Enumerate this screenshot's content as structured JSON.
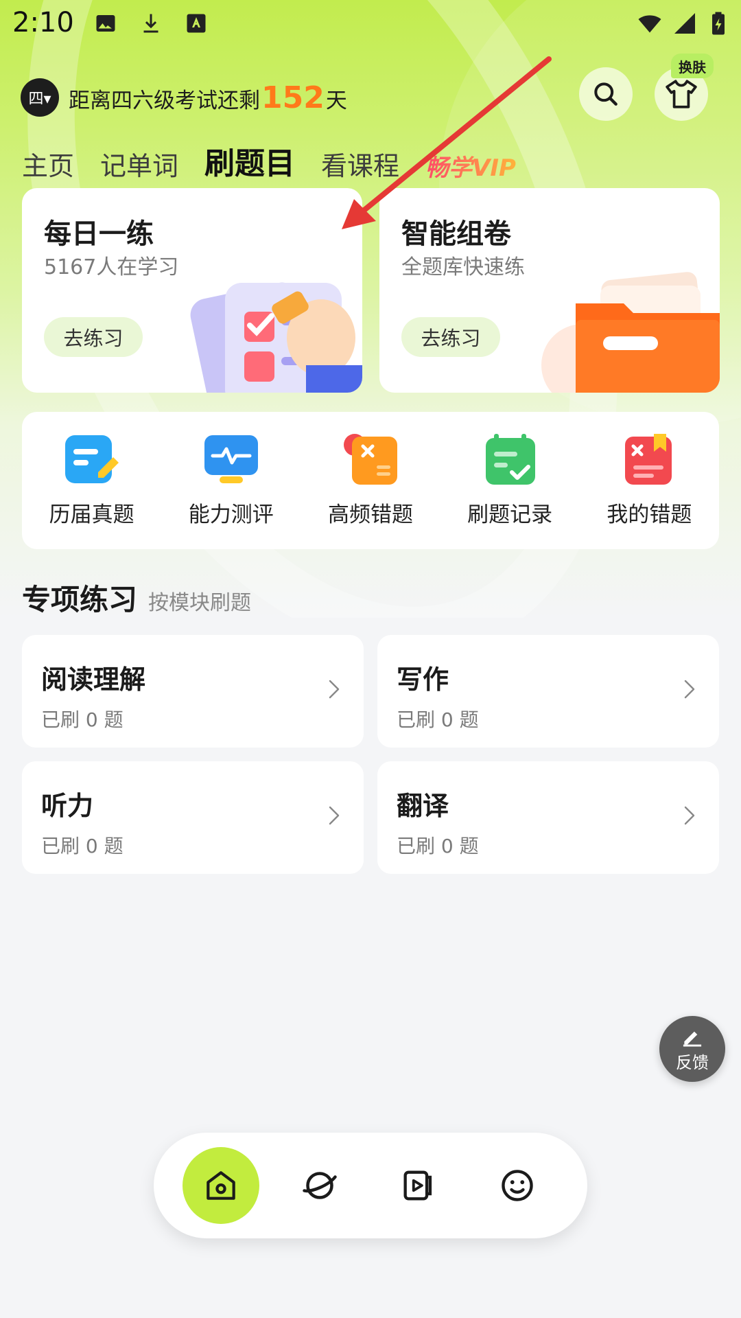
{
  "status_bar": {
    "time": "2:10",
    "left_icons": [
      "image-icon",
      "download-icon",
      "text-a-icon"
    ],
    "right_icons": [
      "wifi-icon",
      "signal-icon",
      "battery-icon"
    ]
  },
  "header": {
    "level_badge": "四▾",
    "countdown_prefix": "距离四六级考试还剩",
    "countdown_days": "152",
    "countdown_suffix": "天",
    "skin_tag": "换肤",
    "icons": [
      "search-icon",
      "tshirt-icon"
    ]
  },
  "tabs": [
    {
      "label": "主页",
      "active": false
    },
    {
      "label": "记单词",
      "active": false
    },
    {
      "label": "刷题目",
      "active": true
    },
    {
      "label": "看课程",
      "active": false
    },
    {
      "label": "畅学VIP",
      "active": false
    }
  ],
  "cards": [
    {
      "title": "每日一练",
      "subtitle": "5167人在学习",
      "button": "去练习",
      "icon": "checklist-illustration"
    },
    {
      "title": "智能组卷",
      "subtitle": "全题库快速练",
      "button": "去练习",
      "icon": "folder-illustration"
    }
  ],
  "quick_access": [
    {
      "label": "历届真题",
      "icon": "exam-paper-icon",
      "color": "#2aa7f5"
    },
    {
      "label": "能力测评",
      "icon": "monitor-pulse-icon",
      "color": "#2f93f0"
    },
    {
      "label": "高频错题",
      "icon": "frequent-mistakes-icon",
      "color": "#ff9a1f"
    },
    {
      "label": "刷题记录",
      "icon": "calendar-check-icon",
      "color": "#3fc46a"
    },
    {
      "label": "我的错题",
      "icon": "mistake-book-icon",
      "color": "#f2494f"
    }
  ],
  "section": {
    "title": "专项练习",
    "subtitle": "按模块刷题"
  },
  "modules": [
    {
      "title": "阅读理解",
      "status": "已刷 0 题"
    },
    {
      "title": "写作",
      "status": "已刷 0 题"
    },
    {
      "title": "听力",
      "status": "已刷 0 题"
    },
    {
      "title": "翻译",
      "status": "已刷 0 题"
    }
  ],
  "feedback": {
    "label": "反馈",
    "icon": "pencil-icon"
  },
  "bottom_nav": [
    {
      "icon": "home-icon",
      "active": true
    },
    {
      "icon": "planet-icon",
      "active": false
    },
    {
      "icon": "video-card-icon",
      "active": false
    },
    {
      "icon": "smiley-icon",
      "active": false
    }
  ],
  "colors": {
    "accent": "#c2ec3e",
    "countdown": "#ff7a1a",
    "annotation_arrow": "#e53935"
  }
}
